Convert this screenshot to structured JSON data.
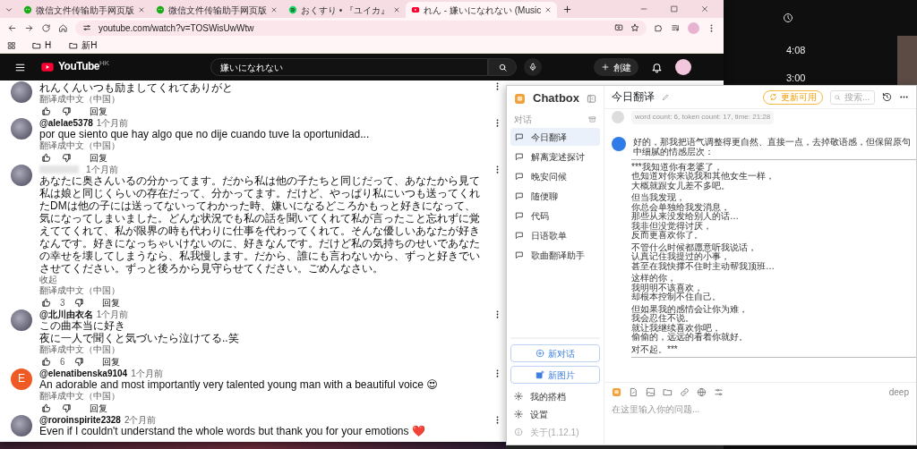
{
  "background_window": {
    "times": [
      "4:08",
      "3:00"
    ]
  },
  "browser": {
    "tabs": [
      {
        "kind": "wechat",
        "title": "微信文件传输助手网页版",
        "selected": false
      },
      {
        "kind": "wechat",
        "title": "微信文件传输助手网页版",
        "selected": false
      },
      {
        "kind": "spotify",
        "title": "おくすり • 『ユイカ』",
        "selected": false
      },
      {
        "kind": "youtube",
        "title": "れん - 嫌いになれない (Music",
        "selected": true
      }
    ],
    "address": "youtube.com/watch?v=TOSWisUwWtw",
    "bookmarks": [
      "H",
      "新H"
    ]
  },
  "youtube": {
    "logo": "YouTube",
    "region": "HK",
    "search": "嫌いになれない",
    "create": "創建"
  },
  "comments": [
    {
      "avatar": {
        "kind": "photo"
      },
      "text": "れんくんいつも励ましてくれてありがと",
      "translate": "翻译成中文（中国）",
      "reply": "回复"
    },
    {
      "avatar": {
        "kind": "photo"
      },
      "author": "@alelae5378",
      "time": "1个月前",
      "text": "por que siento que hay algo que no dije cuando tuve la oportunidad...",
      "translate": "翻译成中文（中国）",
      "reply": "回复"
    },
    {
      "avatar": {
        "kind": "photo"
      },
      "author_blurred": true,
      "time": "1个月前",
      "text": "あなたに奥さんいるの分かってます。だから私は他の子たちと同じだって、あなたから見て私は娘と同じくらいの存在だって、分かってます。だけど、やっぱり私にいつも送ってくれたDMは他の子には送ってないってわかった時、嫌いになるどころかもっと好きになって、気になってしまいました。どんな状況でも私の話を聞いてくれて私が言ったこと忘れずに覚えててくれて、私が限界の時も代わりに仕事を代わってくれて。そんな優しいあなたが好きなんです。好きになっちゃいけないのに、好きなんです。だけど私の気持ちのせいであなたの幸せを壊してしまうなら、私我慢します。だから、誰にも言わないから、ずっと好きでいさせてください。ずっと後ろから見守らせてください。ごめんなさい。",
      "collapse": "收起",
      "translate": "翻译成中文（中国）",
      "likes": "3",
      "reply": "回复"
    },
    {
      "avatar": {
        "kind": "photo"
      },
      "author": "@北川由衣名",
      "time": "1个月前",
      "lines": [
        "この曲本当に好き",
        "夜に一人で聞くと気づいたら泣けてる..笑"
      ],
      "translate": "翻译成中文（中国）",
      "likes": "6",
      "reply": "回复"
    },
    {
      "avatar": {
        "kind": "letter",
        "letter": "E"
      },
      "author": "@elenatibenska9104",
      "time": "1个月前",
      "text": "An adorable and most importantly very talented young man with a beautiful voice 😍",
      "translate": "翻译成中文（中国）",
      "reply": "回复"
    },
    {
      "avatar": {
        "kind": "photo"
      },
      "author": "@roroinspirite2328",
      "time": "2个月前",
      "text": "Even if I couldn't understand the whole words but thank you for your emotions ❤️"
    }
  ],
  "chatbox": {
    "app_name": "Chatbox",
    "section_label": "对话",
    "sessions": [
      {
        "title": "今日翻译",
        "selected": true
      },
      {
        "title": "解离宠述探讨",
        "selected": false
      },
      {
        "title": "晚安问候",
        "selected": false
      },
      {
        "title": "随便聊",
        "selected": false
      },
      {
        "title": "代码",
        "selected": false
      },
      {
        "title": "日语歌单",
        "selected": false
      },
      {
        "title": "歌曲翻译助手",
        "selected": false
      }
    ],
    "new_chat": "新对话",
    "new_image": "新图片",
    "footer": [
      {
        "kind": "partners",
        "label": "我的搭档"
      },
      {
        "kind": "settings",
        "label": "设置"
      },
      {
        "kind": "about",
        "label": "关于(1.12.1)"
      }
    ],
    "title": "今日翻译",
    "update_button": "更新可用",
    "search_placeholder": "搜索...",
    "meta": "word count: 6, token count: 17, time: 21:28",
    "reply_intro": "好的，那我把语气调整得更自然、直接一点，去掉敬语感，但保留原句中细腻的情感层次：",
    "stanzas": [
      [
        "***我知道你有老婆了，",
        "也知道对你来说我和其他女生一样，",
        "大概就跟女儿差不多吧。"
      ],
      [
        "但当我发现，",
        "你总会单独给我发消息，",
        "那些从来没发给别人的话…",
        "我非但没觉得讨厌，",
        "反而更喜欢你了。"
      ],
      [
        "不管什么时候都愿意听我说话，",
        "认真记住我提过的小事，",
        "甚至在我快撑不住时主动帮我顶班…"
      ],
      [
        "这样的你，",
        "我明明不该喜欢，",
        "却根本控制不住自己。"
      ],
      [
        "但如果我的感情会让你为难，",
        "我会忍住不说。",
        "就让我继续喜欢你吧，",
        "偷偷的，远远的看着你就好。"
      ],
      [
        "对不起。***"
      ]
    ],
    "model": "deep",
    "input_placeholder": "在这里输入你的问题..."
  }
}
